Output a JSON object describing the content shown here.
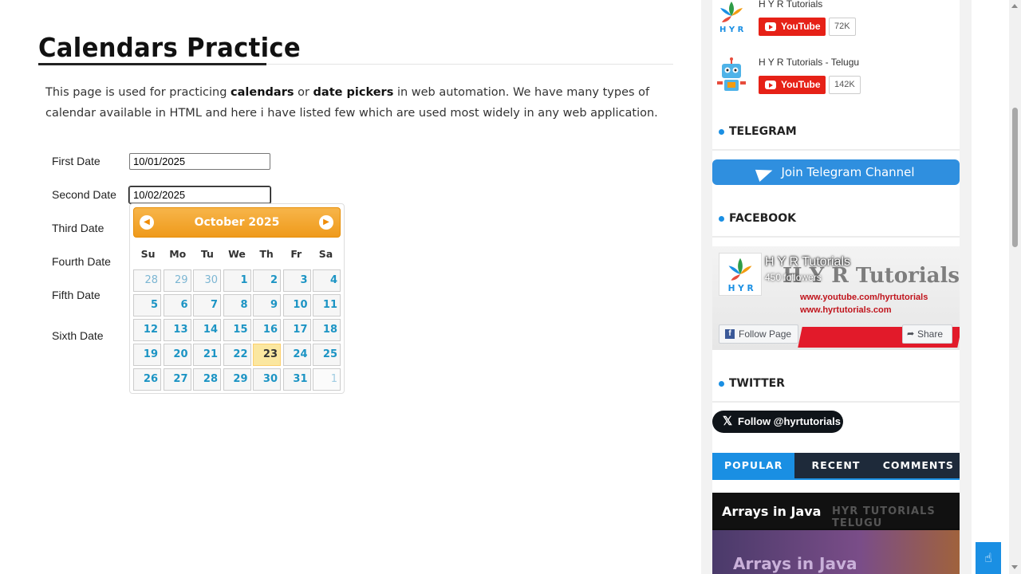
{
  "page": {
    "title": "Calendars Practice",
    "intro_prefix": "This page is used for practicing ",
    "intro_bold1": "calendars",
    "intro_mid": " or ",
    "intro_bold2": "date pickers",
    "intro_suffix": " in web automation. We have many types of calendar available in HTML and here i have listed few which are used most widely in any web application."
  },
  "form": {
    "first_label": "First Date",
    "first_value": "10/01/2025",
    "second_label": "Second Date",
    "second_value": "10/02/2025",
    "third_label": "Third Date",
    "fourth_label": "Fourth Date",
    "fifth_label": "Fifth Date",
    "sixth_label": "Sixth Date"
  },
  "datepicker": {
    "month_year": "October 2025",
    "prev_icon": "chevron-left-icon",
    "next_icon": "chevron-right-icon",
    "weekdays": [
      "Su",
      "Mo",
      "Tu",
      "We",
      "Th",
      "Fr",
      "Sa"
    ],
    "today": "23",
    "days": [
      [
        "28",
        "29",
        "30",
        "1",
        "2",
        "3",
        "4"
      ],
      [
        "5",
        "6",
        "7",
        "8",
        "9",
        "10",
        "11"
      ],
      [
        "12",
        "13",
        "14",
        "15",
        "16",
        "17",
        "18"
      ],
      [
        "19",
        "20",
        "21",
        "22",
        "23",
        "24",
        "25"
      ],
      [
        "26",
        "27",
        "28",
        "29",
        "30",
        "31",
        "1"
      ]
    ]
  },
  "sidebar": {
    "youtube": [
      {
        "name": "H Y R Tutorials",
        "button": "YouTube",
        "subscribers": "72K"
      },
      {
        "name": "H Y R Tutorials - Telugu",
        "button": "YouTube",
        "subscribers": "142K"
      }
    ],
    "telegram": {
      "heading": "TELEGRAM",
      "button": "Join Telegram Channel"
    },
    "facebook": {
      "heading": "FACEBOOK",
      "page_name": "H Y R Tutorials",
      "followers": "450 followers",
      "cover_title": "H Y R Tutorials",
      "cover_url1": "www.youtube.com/hyrtutorials",
      "cover_url2": "www.hyrtutorials.com",
      "follow_button": "Follow Page",
      "share_button": "Share"
    },
    "twitter": {
      "heading": "TWITTER",
      "button": "Follow @hyrtutorials"
    },
    "tabs": [
      "POPULAR",
      "RECENT",
      "COMMENTS"
    ],
    "thumbnail": {
      "title": "Arrays in Java",
      "ghost": "HYR TUTORIALS   TELUGU",
      "bottom_text": "Arrays in Java"
    }
  },
  "colors": {
    "accent": "#1a8fe3",
    "datepicker_header": "#ef9a1b",
    "day_link": "#1c94c4",
    "youtube_red": "#e62117"
  }
}
